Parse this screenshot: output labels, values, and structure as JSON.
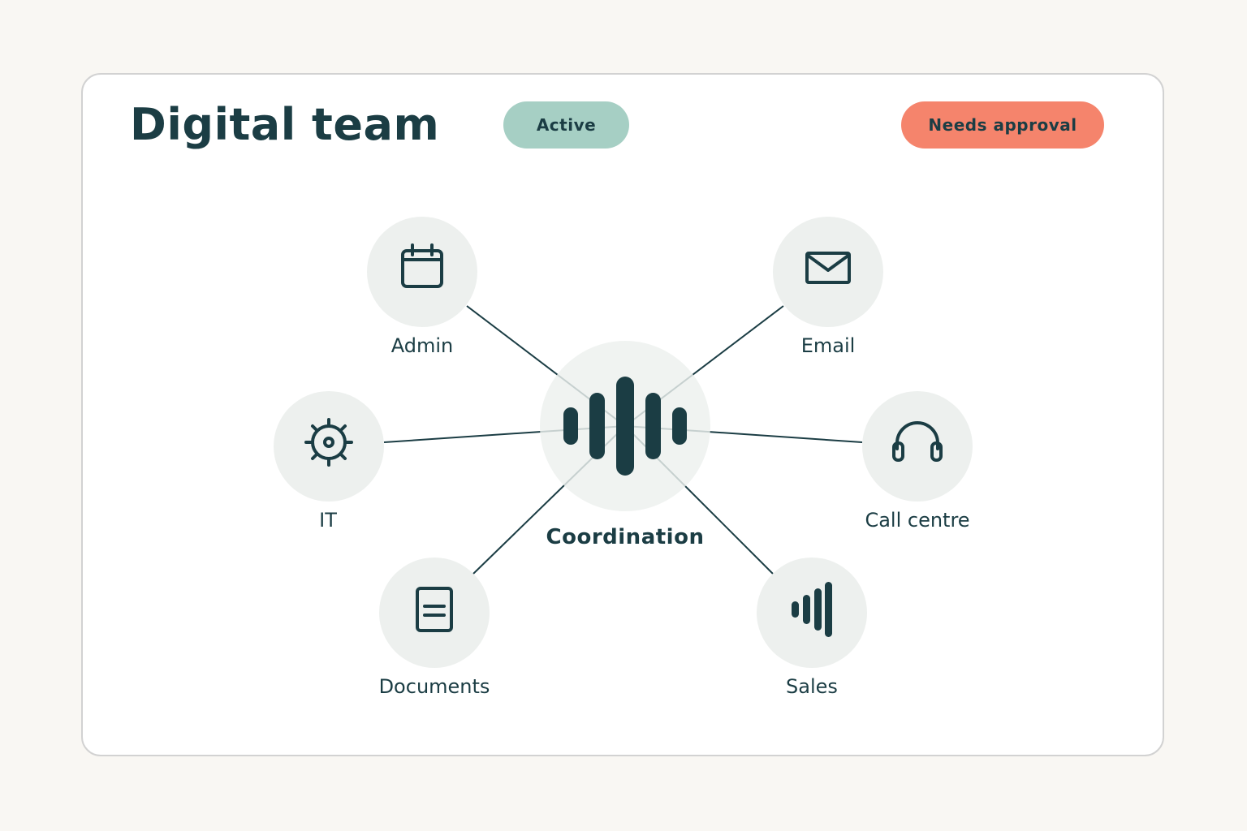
{
  "header": {
    "title": "Digital team",
    "status_badge": "Active",
    "approval_button": "Needs approval"
  },
  "hub": {
    "label": "Coordination",
    "icon": "waveform-icon"
  },
  "nodes": [
    {
      "label": "Admin",
      "icon": "calendar-icon"
    },
    {
      "label": "Email",
      "icon": "envelope-icon"
    },
    {
      "label": "IT",
      "icon": "gear-icon"
    },
    {
      "label": "Call centre",
      "icon": "headset-icon"
    },
    {
      "label": "Documents",
      "icon": "document-icon"
    },
    {
      "label": "Sales",
      "icon": "signal-bars-icon"
    }
  ],
  "colors": {
    "background": "#f9f7f3",
    "card": "#ffffff",
    "text": "#1b3d44",
    "active": "#a6cfc4",
    "approval": "#f5846c",
    "node_fill": "#edf0ee"
  }
}
